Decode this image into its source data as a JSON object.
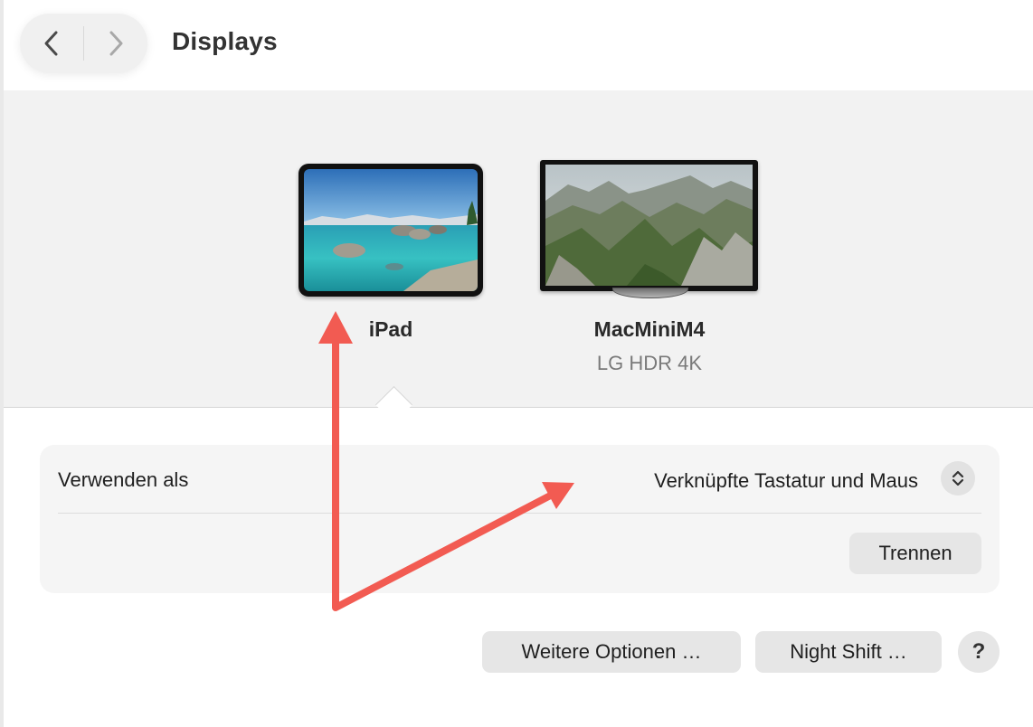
{
  "header": {
    "title": "Displays",
    "back_icon": "chevron-left-icon",
    "forward_icon": "chevron-right-icon"
  },
  "displays": [
    {
      "name": "iPad",
      "subtitle": "",
      "selected": true
    },
    {
      "name": "MacMiniM4",
      "subtitle": "LG HDR 4K",
      "selected": false
    }
  ],
  "settings": {
    "use_as_label": "Verwenden als",
    "use_as_value": "Verknüpfte Tastatur und Maus",
    "disconnect_label": "Trennen"
  },
  "footer": {
    "more_options_label": "Weitere Optionen …",
    "night_shift_label": "Night Shift …",
    "help_label": "?"
  },
  "colors": {
    "annotation_arrow": "#f25b52",
    "panel_background": "#f2f2f2"
  }
}
